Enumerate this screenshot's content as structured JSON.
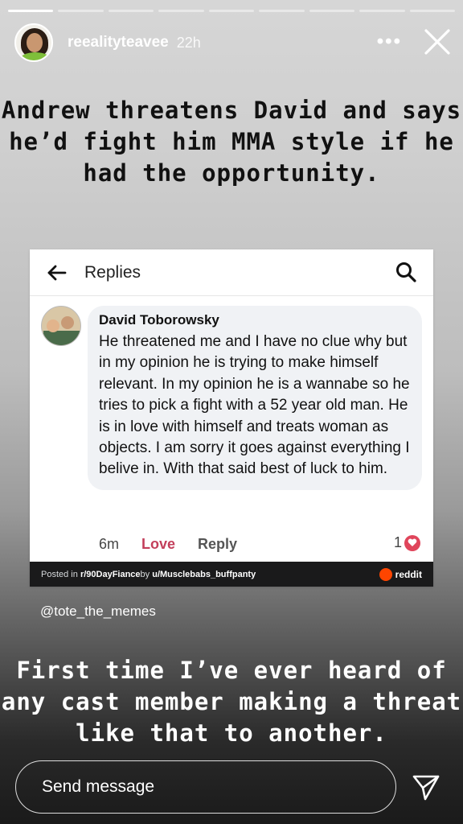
{
  "progress": {
    "segments": 9,
    "completed": 1
  },
  "header": {
    "username": "reealityteavee",
    "time": "22h",
    "more_label": "•••"
  },
  "caption_top": "Andrew threatens David and says he’d fight him MMA style if he had the opportunity.",
  "card": {
    "title": "Replies",
    "comment": {
      "author": "David Toborowsky",
      "text": "He threatened me and I have no clue why but in my opinion he is trying to make himself relevant. In my opinion he is a wannabe so he tries to pick a fight with a 52 year old man. He is in love with himself and treats woman as objects. I am sorry it goes against everything I belive in. With that said best of luck to him.",
      "age": "6m",
      "love_label": "Love",
      "reply_label": "Reply",
      "reaction_count": "1"
    },
    "footer": {
      "posted_prefix": "Posted in ",
      "subreddit": "r/90DayFiance",
      "by": " by ",
      "user": "u/Musclebabs_buffpanty",
      "brand": "reddit"
    }
  },
  "mention": "@tote_the_memes",
  "caption_bottom": "First time I’ve ever heard of any cast member making a threat like that to another.",
  "message_bar": {
    "placeholder": "Send message"
  },
  "colors": {
    "love": "#c33f5b",
    "heart": "#e0455b",
    "reddit": "#ff4500"
  }
}
